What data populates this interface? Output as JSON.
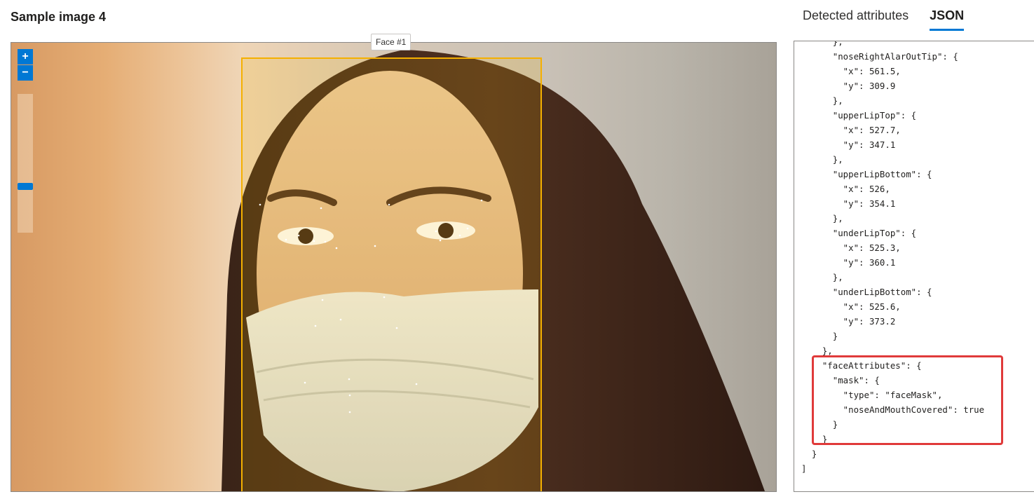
{
  "page": {
    "title": "Sample image 4"
  },
  "tabs": [
    {
      "label": "Detected attributes",
      "active": false
    },
    {
      "label": "JSON",
      "active": true
    }
  ],
  "viewer": {
    "face_label": "Face #1",
    "zoom_in_symbol": "+",
    "zoom_out_symbol": "−",
    "zoom_level": 0.3,
    "box_color": "#f5b000",
    "accent_color": "#0078d4"
  },
  "json_lines": [
    "      },",
    "      \"noseRightAlarOutTip\": {",
    "        \"x\": 561.5,",
    "        \"y\": 309.9",
    "      },",
    "      \"upperLipTop\": {",
    "        \"x\": 527.7,",
    "        \"y\": 347.1",
    "      },",
    "      \"upperLipBottom\": {",
    "        \"x\": 526,",
    "        \"y\": 354.1",
    "      },",
    "      \"underLipTop\": {",
    "        \"x\": 525.3,",
    "        \"y\": 360.1",
    "      },",
    "      \"underLipBottom\": {",
    "        \"x\": 525.6,",
    "        \"y\": 373.2",
    "      }",
    "    },",
    "    \"faceAttributes\": {",
    "      \"mask\": {",
    "        \"type\": \"faceMask\",",
    "        \"noseAndMouthCovered\": true",
    "      }",
    "    }",
    "  }",
    "]"
  ],
  "highlight_color": "#e03a3a"
}
